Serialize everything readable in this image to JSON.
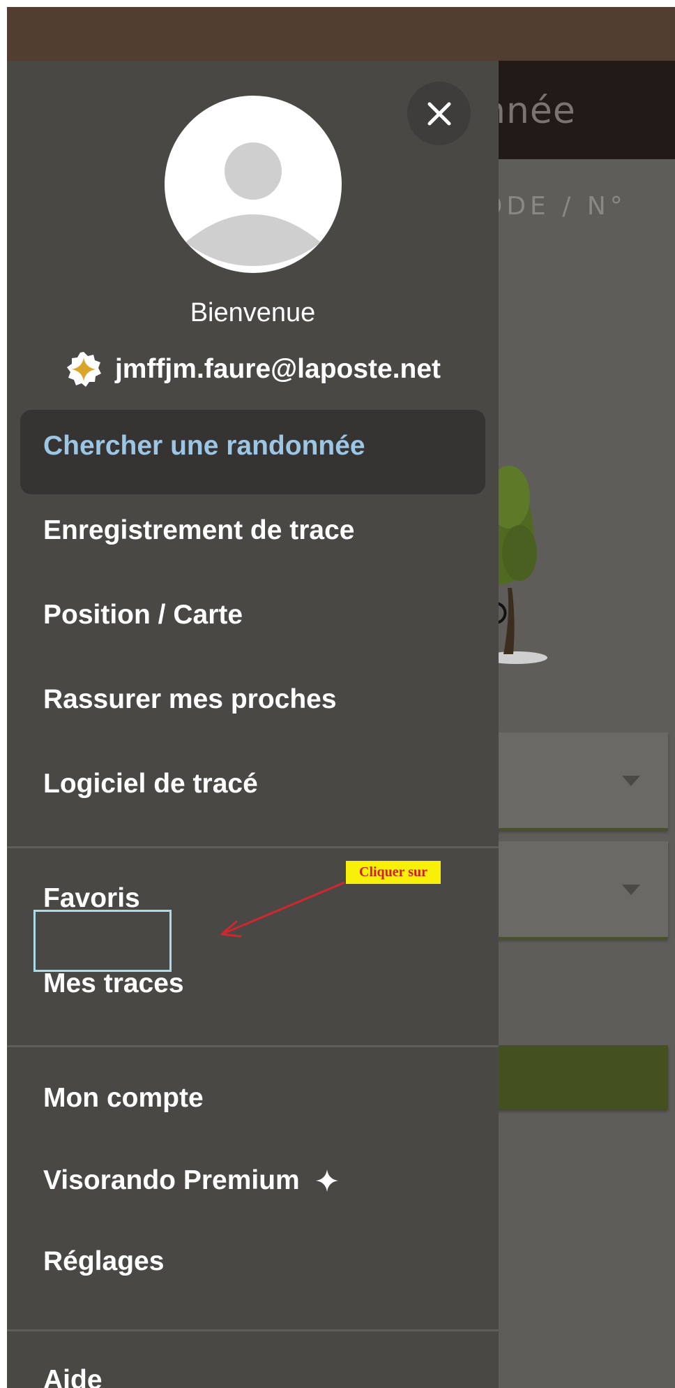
{
  "app": {
    "title_partial": "nnée",
    "code_label_partial": "ODE / N°"
  },
  "drawer": {
    "welcome": "Bienvenue",
    "user_email": "jmffjm.faure@laposte.net",
    "menu": {
      "group1": [
        "Chercher une randonnée",
        "Enregistrement de trace",
        "Position / Carte",
        "Rassurer mes proches",
        "Logiciel de tracé"
      ],
      "group2": [
        "Favoris",
        "Mes traces"
      ],
      "group3": [
        "Mon compte",
        "Visorando Premium",
        "Réglages"
      ],
      "group4": [
        "Aide"
      ]
    },
    "active_item": "Chercher une randonnée"
  },
  "annotation": {
    "label": "Cliquer sur"
  },
  "colors": {
    "status_bar": "#523d31",
    "drawer_bg": "#4a4845",
    "active_text": "#9cc6e6",
    "premium_gold": "#d9a62b",
    "highlight_border": "#a8dcea",
    "annotation_bg": "#f9f00a",
    "annotation_text": "#d41d1d",
    "accent_green": "#44501f"
  },
  "icons": {
    "close": "close-icon",
    "avatar": "default-avatar-icon",
    "premium": "premium-sparkle-icon"
  }
}
